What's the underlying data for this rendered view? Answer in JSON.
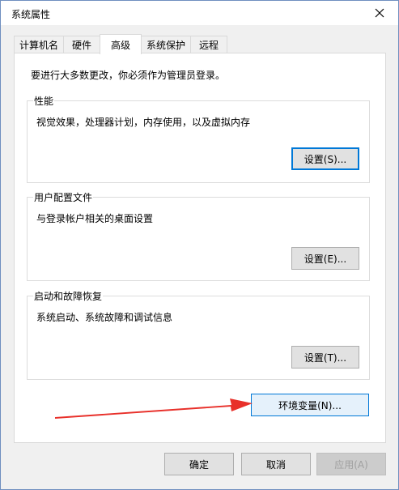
{
  "window": {
    "title": "系统属性"
  },
  "tabs": [
    {
      "label": "计算机名"
    },
    {
      "label": "硬件"
    },
    {
      "label": "高级"
    },
    {
      "label": "系统保护"
    },
    {
      "label": "远程"
    }
  ],
  "active_tab": "高级",
  "notice": "要进行大多数更改，你必须作为管理员登录。",
  "groups": {
    "performance": {
      "title": "性能",
      "description": "视觉效果，处理器计划，内存使用，以及虚拟内存",
      "button": "设置(S)..."
    },
    "user_profiles": {
      "title": "用户配置文件",
      "description": "与登录帐户相关的桌面设置",
      "button": "设置(E)..."
    },
    "startup_recovery": {
      "title": "启动和故障恢复",
      "description": "系统启动、系统故障和调试信息",
      "button": "设置(T)..."
    }
  },
  "env_button": "环境变量(N)...",
  "footer": {
    "ok": "确定",
    "cancel": "取消",
    "apply": "应用(A)"
  },
  "colors": {
    "accent": "#0078d7",
    "annotation_arrow": "#e8302a",
    "hover_fill": "#e5f1fb"
  },
  "icons": {
    "close": "close-icon",
    "annotation": "red-arrow"
  }
}
